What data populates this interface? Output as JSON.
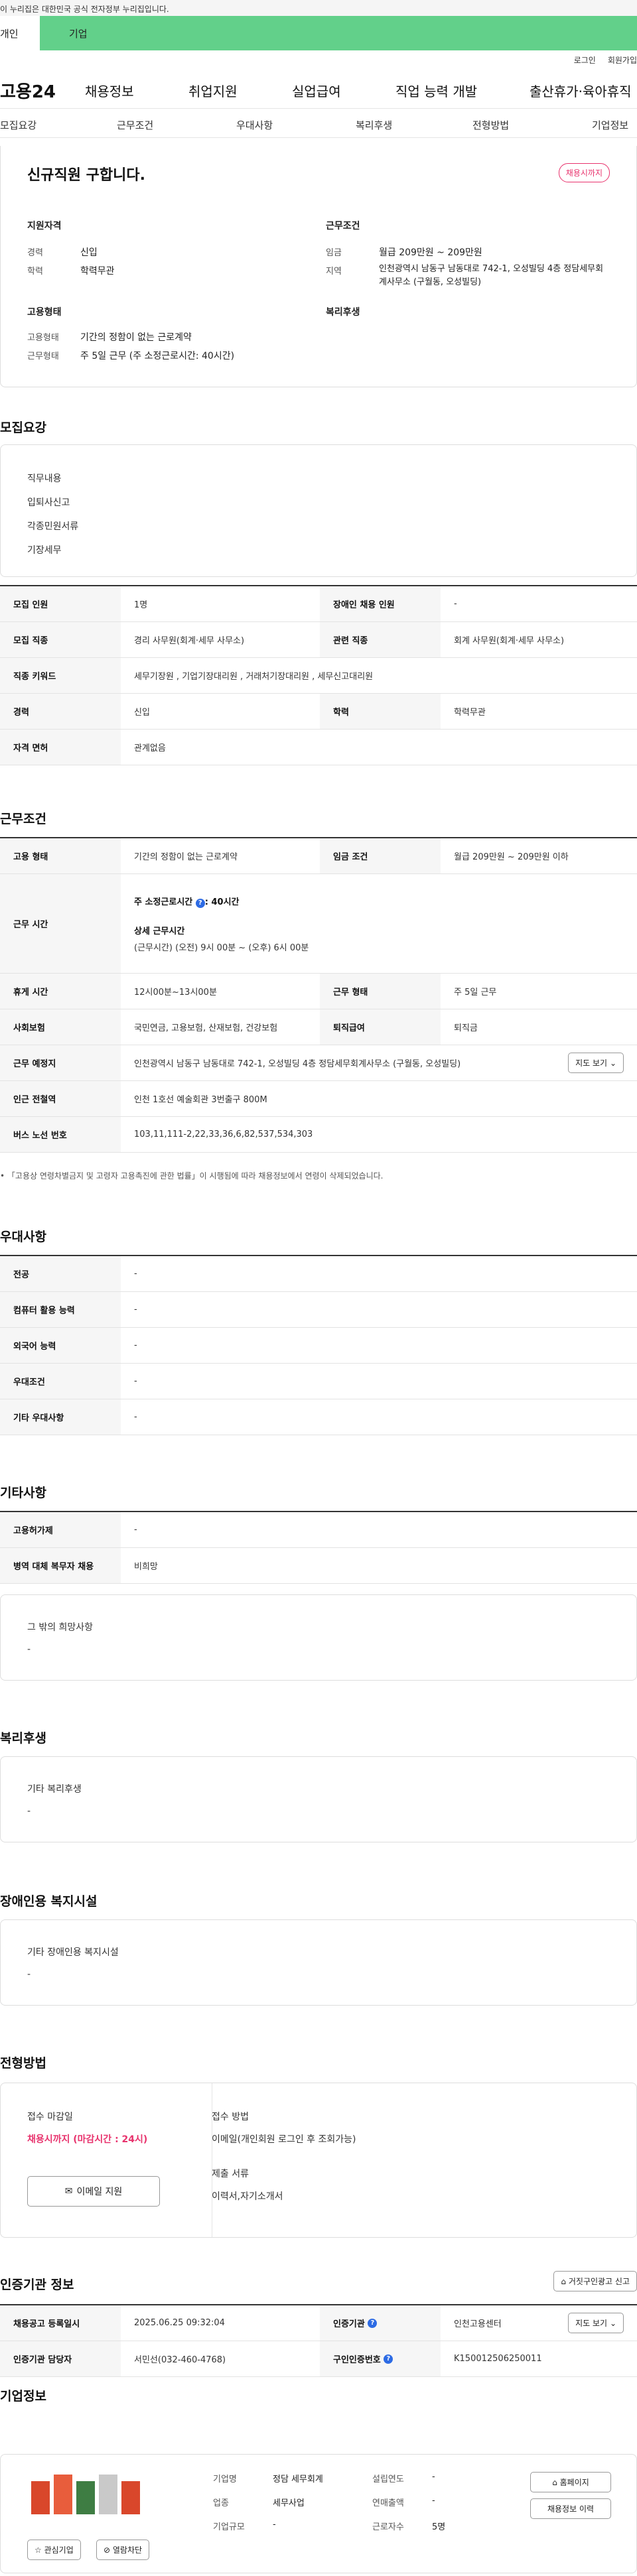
{
  "gov_banner": "이 누리집은 대한민국 공식 전자정부 누리집입니다.",
  "tabs": {
    "personal": "개인",
    "company": "기업"
  },
  "util": {
    "login": "로그인",
    "join": "회원가입"
  },
  "logo": "고용24",
  "gnb": [
    "채용정보",
    "취업지원",
    "실업급여",
    "직업 능력 개발",
    "출산휴가·육아휴직"
  ],
  "subnav": [
    "모집요강",
    "근무조건",
    "우대사항",
    "복리후생",
    "전형방법",
    "기업정보"
  ],
  "summary": {
    "title": "신규직원 구합니다.",
    "status": "채용시까지",
    "qual_heading": "지원자격",
    "career_label": "경력",
    "career": "신입",
    "edu_label": "학력",
    "edu": "학력무관",
    "cond_heading": "근무조건",
    "wage_label": "임금",
    "wage": "월급 209만원 ~ 209만원",
    "area_label": "지역",
    "area": "인천광역시 남동구 남동대로 742-1, 오성빌딩 4층 정담세무회계사무소 (구월동, 오성빌딩)",
    "type_heading": "고용형태",
    "emp_label": "고용형태",
    "emp": "기간의 정함이 없는 근로계약",
    "hours_label": "근무형태",
    "hours": "주 5일 근무 (주 소정근로시간: 40시간)",
    "welfare_heading": "복리후생"
  },
  "recruit": {
    "title": "모집요강",
    "duties_heading": "직무내용",
    "duties": [
      "입퇴사신고",
      "각종민원서류",
      "기장세무"
    ],
    "rows": [
      {
        "h1": "모집 인원",
        "v1": "1명",
        "h2": "장애인 채용 인원",
        "v2": "-"
      },
      {
        "h1": "모집 직종",
        "v1": "경리 사무원(회계·세무 사무소)",
        "h2": "관련 직종",
        "v2": "회계 사무원(회계·세무 사무소)"
      },
      {
        "h1": "직종 키워드",
        "v1": "세무기장원 , 기업기장대리원 , 거래처기장대리원 , 세무신고대리원"
      },
      {
        "h1": "경력",
        "v1": "신입",
        "h2": "학력",
        "v2": "학력무관"
      },
      {
        "h1": "자격 면허",
        "v1": "관계없음"
      }
    ]
  },
  "conditions": {
    "title": "근무조건",
    "emp_type_label": "고용 형태",
    "emp_type": "기간의 정함이 없는 근로계약",
    "wage_label": "임금 조건",
    "wage": "월급 209만원 ~ 209만원 이하",
    "time_label": "근무 시간",
    "weekly": "주 소정근로시간",
    "weekly_val": ": 40시간",
    "detail_heading": "상세 근무시간",
    "detail": "(근무시간) (오전) 9시 00분 ~ (오후) 6시 00분",
    "break_label": "휴게 시간",
    "break": "12시00분~13시00분",
    "shift_label": "근무 형태",
    "shift": "주 5일 근무",
    "ins_label": "사회보험",
    "ins": "국민연금, 고용보험, 산재보험, 건강보험",
    "sev_label": "퇴직급여",
    "sev": "퇴직금",
    "place_label": "근무 예정지",
    "place": "인천광역시 남동구 남동대로 742-1, 오성빌딩 4층 정담세무회계사무소 (구월동, 오성빌딩)",
    "map_btn": "지도 보기",
    "subway_label": "인근 전철역",
    "subway": "인천 1호선 예술회관 3번출구 800M",
    "bus_label": "버스 노선 번호",
    "bus": "103,11,111-2,22,33,36,6,82,537,534,303",
    "note": "「고용상 연령차별금지 및 고령자 고용촉진에 관한 법률」이 시행됨에 따라 채용정보에서 연령이 삭제되었습니다."
  },
  "preference": {
    "title": "우대사항",
    "rows": [
      {
        "h": "전공",
        "v": "-"
      },
      {
        "h": "컴퓨터 활용 능력",
        "v": "-"
      },
      {
        "h": "외국어 능력",
        "v": "-"
      },
      {
        "h": "우대조건",
        "v": "-"
      },
      {
        "h": "기타 우대사항",
        "v": "-"
      }
    ]
  },
  "other": {
    "title": "기타사항",
    "rows": [
      {
        "h": "고용허가제",
        "v": "-"
      },
      {
        "h": "병역 대체 복무자 채용",
        "v": "비희망"
      }
    ],
    "etc_heading": "그 밖의 희망사항",
    "etc": "-"
  },
  "welfare": {
    "title": "복리후생",
    "heading": "기타 복리후생",
    "value": "-"
  },
  "disability": {
    "title": "장애인용 복지시설",
    "heading": "기타 장애인용 복지시설",
    "value": "-"
  },
  "screening": {
    "title": "전형방법",
    "deadline_label": "접수 마감일",
    "deadline": "채용시까지 (마감시간 : 24시)",
    "email_btn": "이메일 지원",
    "method_label": "접수 방법",
    "method": "이메일(개인회원 로그인 후 조회가능)",
    "docs_label": "제출 서류",
    "docs": "이력서,자기소개서"
  },
  "agency": {
    "title": "인증기관 정보",
    "report_btn": "거짓구인광고 신고",
    "reg_label": "채용공고 등록일시",
    "reg": "2025.06.25 09:32:04",
    "agency_label": "인증기관",
    "agency": "인천고용센터",
    "map_btn": "지도 보기",
    "mgr_label": "인증기관 담당자",
    "mgr": "서민선(032-460-4768)",
    "no_label": "구인인증번호",
    "no": "K150012506250011"
  },
  "company": {
    "title": "기업정보",
    "name_label": "기업명",
    "name": "정담 세무회계",
    "year_label": "설립연도",
    "year": "-",
    "industry_label": "업종",
    "industry": "세무사업",
    "sales_label": "연매출액",
    "sales": "-",
    "size_label": "기업규모",
    "size": "-",
    "staff_label": "근로자수",
    "staff": "5명",
    "homepage_btn": "홈페이지",
    "history_btn": "채용정보 이력",
    "fav_btn": "관심기업",
    "block_btn": "열람차단"
  },
  "colors": {
    "accent_green": "#62d08a",
    "pink": "#e8336d",
    "blue": "#2d6be4"
  }
}
